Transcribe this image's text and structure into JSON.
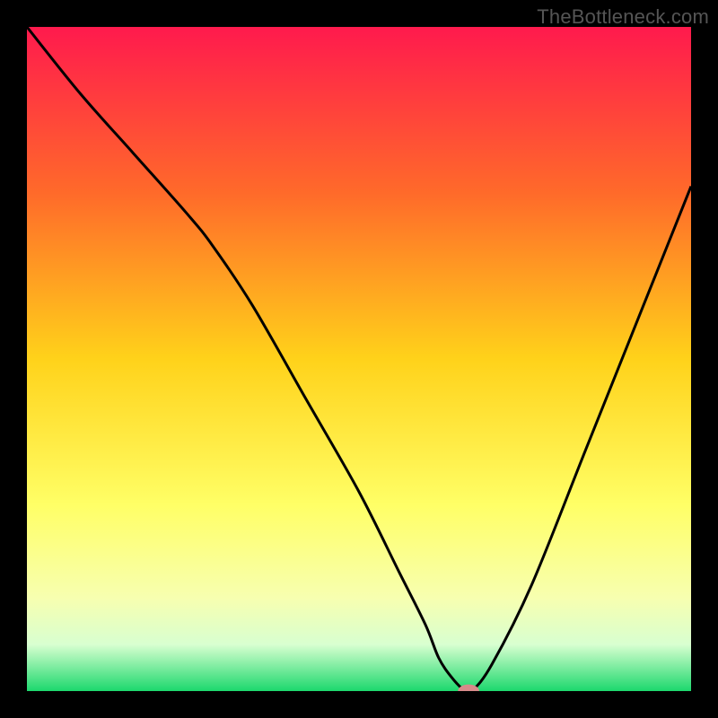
{
  "watermark": "TheBottleneck.com",
  "chart_data": {
    "type": "line",
    "title": "",
    "xlabel": "",
    "ylabel": "",
    "xlim": [
      0,
      100
    ],
    "ylim": [
      0,
      100
    ],
    "background_gradient": {
      "stops": [
        {
          "offset": 0,
          "color": "#ff1a4d"
        },
        {
          "offset": 25,
          "color": "#ff6a2a"
        },
        {
          "offset": 50,
          "color": "#ffd21a"
        },
        {
          "offset": 72,
          "color": "#ffff66"
        },
        {
          "offset": 86,
          "color": "#f7ffb0"
        },
        {
          "offset": 93,
          "color": "#d8ffd0"
        },
        {
          "offset": 100,
          "color": "#1cd86d"
        }
      ]
    },
    "series": [
      {
        "name": "bottleneck-curve",
        "x": [
          0,
          8,
          16,
          24,
          28,
          34,
          42,
          50,
          56,
          60,
          62,
          64,
          66,
          67,
          70,
          76,
          84,
          92,
          100
        ],
        "y": [
          100,
          90,
          81,
          72,
          67,
          58,
          44,
          30,
          18,
          10,
          5,
          2,
          0,
          0,
          4,
          16,
          36,
          56,
          76
        ]
      }
    ],
    "marker": {
      "name": "optimal-point",
      "x": 66.5,
      "y": 0,
      "rx": 1.6,
      "ry": 1.0,
      "fill": "#d88a8a"
    }
  }
}
